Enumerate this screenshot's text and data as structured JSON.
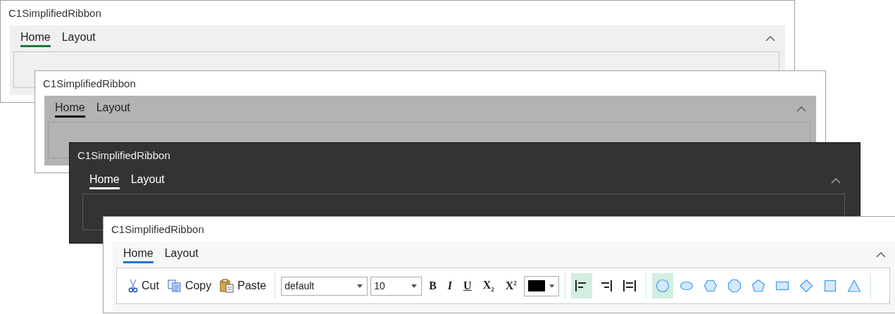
{
  "windows": [
    {
      "title": "C1SimplifiedRibbon",
      "kind": "light",
      "tabs": [
        {
          "label": "Home",
          "selected": true
        },
        {
          "label": "Layout",
          "selected": false
        }
      ]
    },
    {
      "title": "C1SimplifiedRibbon",
      "kind": "gray",
      "tabs": [
        {
          "label": "Home",
          "selected": true
        },
        {
          "label": "Layout",
          "selected": false
        }
      ]
    },
    {
      "title": "C1SimplifiedRibbon",
      "kind": "dark",
      "tabs": [
        {
          "label": "Home",
          "selected": true
        },
        {
          "label": "Layout",
          "selected": false
        }
      ]
    },
    {
      "title": "C1SimplifiedRibbon",
      "kind": "blue",
      "tabs": [
        {
          "label": "Home",
          "selected": true
        },
        {
          "label": "Layout",
          "selected": false
        }
      ],
      "toolbar": {
        "clipboard": [
          {
            "label": "Cut",
            "kind": "cut"
          },
          {
            "label": "Copy",
            "kind": "copy"
          },
          {
            "label": "Paste",
            "kind": "paste"
          }
        ],
        "font_name": "default",
        "font_size": "10",
        "format": [
          {
            "label": "B",
            "kind": "bold"
          },
          {
            "label": "I",
            "kind": "italic"
          },
          {
            "label": "U",
            "kind": "underline"
          },
          {
            "label": "X$_{2}$",
            "kind": "subscript"
          },
          {
            "label": "X$^{2}$",
            "kind": "superscript"
          }
        ],
        "color_picker": {
          "color": "#000000"
        },
        "alignment": [
          {
            "kind": "left",
            "selected": true
          },
          {
            "kind": "right",
            "selected": false
          },
          {
            "kind": "justify",
            "selected": false
          }
        ],
        "shapes": [
          {
            "kind": "circle",
            "selected": true
          },
          {
            "kind": "ellipse",
            "selected": false
          },
          {
            "kind": "hexagon",
            "selected": false
          },
          {
            "kind": "octagon",
            "selected": false
          },
          {
            "kind": "pentagon",
            "selected": false
          },
          {
            "kind": "rectangle",
            "selected": false
          },
          {
            "kind": "diamond",
            "selected": false
          },
          {
            "kind": "square",
            "selected": false
          },
          {
            "kind": "triangle",
            "selected": false
          }
        ]
      }
    }
  ]
}
